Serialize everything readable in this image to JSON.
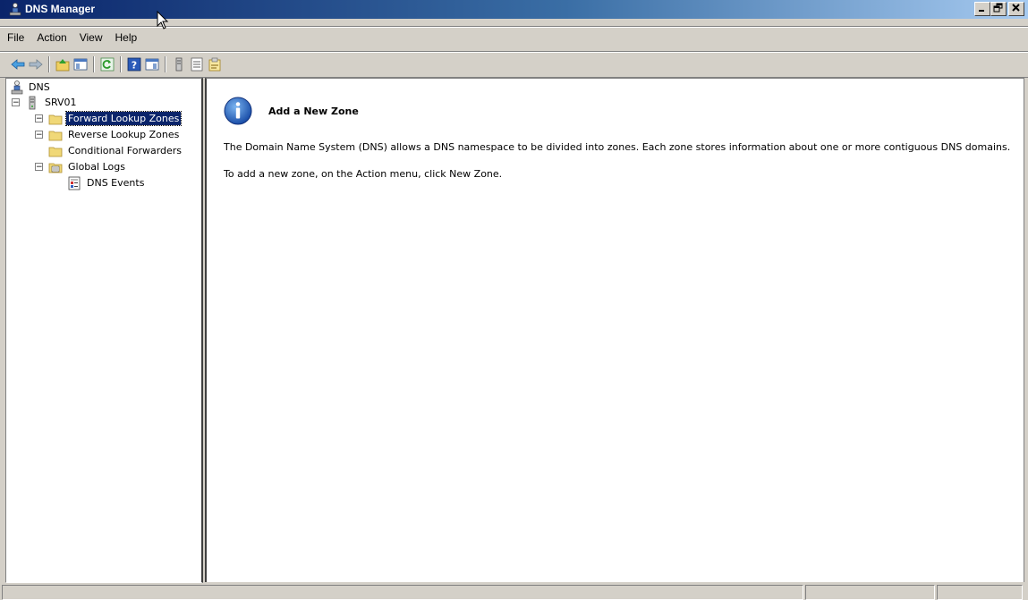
{
  "window": {
    "title": "DNS Manager"
  },
  "caption_buttons": {
    "minimize": "_",
    "restore": "▫",
    "close": "×"
  },
  "menu": [
    {
      "label": "File"
    },
    {
      "label": "Action"
    },
    {
      "label": "View"
    },
    {
      "label": "Help"
    }
  ],
  "toolbar": {
    "buttons": [
      "back-icon",
      "forward-icon",
      "up-icon",
      "show-hide-tree-icon",
      "refresh-icon",
      "help-icon",
      "show-hide-action-pane-icon",
      "server-icon",
      "list-icon",
      "properties-icon"
    ]
  },
  "tree": {
    "root": "DNS",
    "server": "SRV01",
    "items": [
      {
        "label": "Forward Lookup Zones",
        "selected": true
      },
      {
        "label": "Reverse Lookup Zones"
      },
      {
        "label": "Conditional Forwarders"
      },
      {
        "label": "Global Logs"
      },
      {
        "label": "DNS Events"
      }
    ]
  },
  "content": {
    "heading": "Add a New Zone",
    "paragraph1": "The Domain Name System (DNS) allows a DNS namespace to be divided into zones. Each zone stores information about one or more contiguous DNS domains.",
    "paragraph2": "To add a new zone, on the Action menu, click New Zone."
  },
  "colors": {
    "title_bar": "#0a246a",
    "selection": "#0a246a",
    "chrome": "#d4d0c8"
  }
}
